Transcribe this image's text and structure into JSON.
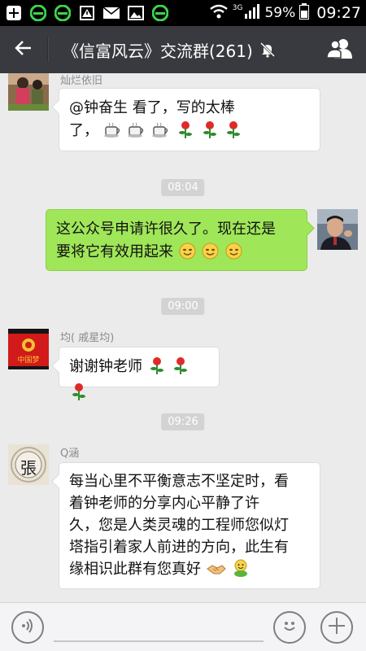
{
  "status_bar": {
    "network": "3G",
    "battery": "59%",
    "time": "09:27",
    "icons": [
      "plus-notification-icon",
      "browser-e-icon",
      "browser-e-icon",
      "warning-icon",
      "mail-icon",
      "image-icon",
      "browser-e-icon",
      "wifi-icon",
      "signal-icon",
      "battery-icon"
    ]
  },
  "header": {
    "title": "《信富风云》交流群(261)",
    "back_icon": "back-arrow-icon",
    "mute_icon": "mute-bell-icon",
    "members_icon": "group-members-icon",
    "bg_color": "#393a3f"
  },
  "messages": [
    {
      "sender": "灿烂依旧",
      "side": "left",
      "lines": [
        "@钟奋生 看了，写的太棒",
        "了，"
      ],
      "emoji": [
        "coffee-emoji",
        "coffee-emoji",
        "coffee-emoji",
        "rose-emoji",
        "rose-emoji",
        "rose-emoji"
      ]
    },
    {
      "time": "08:04"
    },
    {
      "side": "right",
      "lines": [
        "这公众号申请许很久了。现在还是",
        "要将它有效用起来"
      ],
      "emoji": [
        "smile-emoji",
        "smile-emoji",
        "smile-emoji"
      ]
    },
    {
      "time": "09:00"
    },
    {
      "sender": "均( 戚星均)",
      "side": "left",
      "lines": [
        "谢谢钟老师"
      ],
      "emoji": [
        "rose-emoji",
        "rose-emoji",
        "rose-emoji"
      ],
      "avatar_text": "中国梦"
    },
    {
      "time": "09:26"
    },
    {
      "sender": "Q涵",
      "side": "left",
      "lines": [
        "每当心里不平衡意志不坚定时，看",
        "着钟老师的分享内心平静了许",
        "久，您是人类灵魂的工程师您似灯",
        "塔指引着家人前进的方向，此生有",
        "缘相识此群有您真好"
      ],
      "emoji": [
        "handshake-emoji",
        "hug-emoji"
      ],
      "avatar_text": "張"
    }
  ],
  "colors": {
    "chat_bg": "#ebebeb",
    "own_bubble": "#9fe659",
    "other_bubble": "#ffffff"
  },
  "bottom_bar": {
    "voice_icon": "voice-icon",
    "emoji_icon": "emoji-face-icon",
    "plus_icon": "plus-icon"
  }
}
